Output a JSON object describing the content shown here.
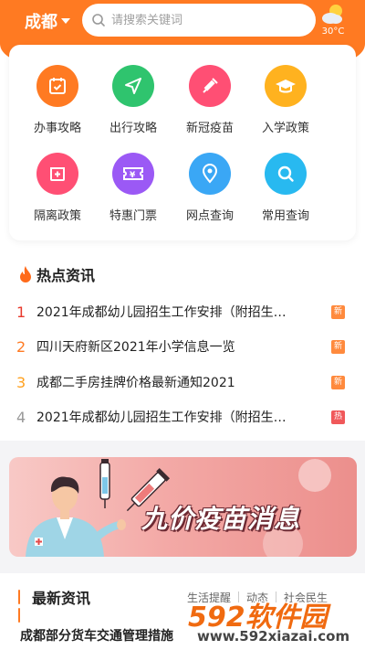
{
  "header": {
    "city": "成都",
    "search_placeholder": "请搜索关键词",
    "temperature": "30°C"
  },
  "services": [
    {
      "label": "办事攻略",
      "icon": "calendar-icon",
      "color": "#ff7a22"
    },
    {
      "label": "出行攻略",
      "icon": "send-icon",
      "color": "#2fc46e"
    },
    {
      "label": "新冠疫苗",
      "icon": "syringe-icon",
      "color": "#ff4f74"
    },
    {
      "label": "入学政策",
      "icon": "graduation-cap-icon",
      "color": "#ffb21f"
    },
    {
      "label": "隔离政策",
      "icon": "isolation-icon",
      "color": "#ff4f74"
    },
    {
      "label": "特惠门票",
      "icon": "ticket-icon",
      "color": "#9b59f5"
    },
    {
      "label": "网点查询",
      "icon": "location-icon",
      "color": "#3aa7f5"
    },
    {
      "label": "常用查询",
      "icon": "search-icon",
      "color": "#28b9f0"
    }
  ],
  "hot_news": {
    "title": "热点资讯",
    "items": [
      {
        "num": "1",
        "text": "2021年成都幼儿园招生工作安排（附招生…",
        "tag": "新",
        "num_color": "#e8392c",
        "tag_color": "#ff8a3d"
      },
      {
        "num": "2",
        "text": "四川天府新区2021年小学信息一览",
        "tag": "新",
        "num_color": "#ff7a22",
        "tag_color": "#ff8a3d"
      },
      {
        "num": "3",
        "text": "成都二手房挂牌价格最新通知2021",
        "tag": "新",
        "num_color": "#ffa11f",
        "tag_color": "#ff8a3d"
      },
      {
        "num": "4",
        "text": "2021年成都幼儿园招生工作安排（附招生…",
        "tag": "热",
        "num_color": "#999999",
        "tag_color": "#f0585a"
      }
    ]
  },
  "banner": {
    "text": "九价疫苗消息"
  },
  "latest_news": {
    "title": "最新资讯",
    "tabs": [
      "生活提醒",
      "动态",
      "社会民生"
    ],
    "first_item": "成都部分货车交通管理措施"
  },
  "watermark": {
    "logo_num": "592",
    "logo_text": "软件园",
    "url": "www.592xiazai.com"
  }
}
